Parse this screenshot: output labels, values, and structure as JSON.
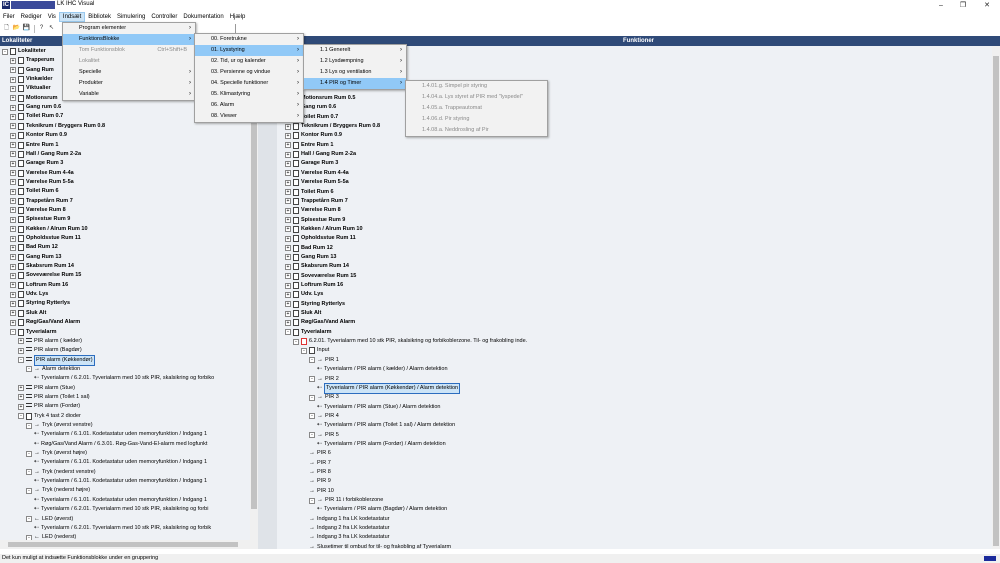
{
  "window": {
    "title": "LK IHC Visual",
    "logo": "IC",
    "minimize": "–",
    "maximize": "❐",
    "close": "✕"
  },
  "menubar": [
    "Filer",
    "Rediger",
    "Vis",
    "Indsæt",
    "Bibliotek",
    "Simulering",
    "Controller",
    "Dokumentation",
    "Hjælp"
  ],
  "toolbar": {
    "icons": [
      "new-icon",
      "open-icon",
      "save-icon",
      "help-icon",
      "pointer-icon"
    ]
  },
  "panes": {
    "left_title": "Lokaliteter",
    "right_title": "Funktioner"
  },
  "indsaet_menu": [
    {
      "label": "Program elementer",
      "has_sub": true,
      "disabled": false,
      "highlighted": false,
      "shortcut": ""
    },
    {
      "label": "FunktionsBlokke",
      "has_sub": true,
      "disabled": false,
      "highlighted": true,
      "shortcut": ""
    },
    {
      "label": "Tom Funktionsblok",
      "has_sub": false,
      "disabled": true,
      "highlighted": false,
      "shortcut": "Ctrl+Shift+B"
    },
    {
      "label": "Lokalitet",
      "has_sub": false,
      "disabled": true,
      "highlighted": false,
      "shortcut": ""
    },
    {
      "label": "Specielle",
      "has_sub": true,
      "disabled": false,
      "highlighted": false,
      "shortcut": ""
    },
    {
      "label": "Produkter",
      "has_sub": true,
      "disabled": false,
      "highlighted": false,
      "shortcut": ""
    },
    {
      "label": "Variable",
      "has_sub": true,
      "disabled": false,
      "highlighted": false,
      "shortcut": ""
    }
  ],
  "funktionsblokke_menu": [
    {
      "label": "00. Foretrukne",
      "highlighted": false
    },
    {
      "label": "01. Lysstyring",
      "highlighted": true
    },
    {
      "label": "02. Tid, ur og kalender",
      "highlighted": false
    },
    {
      "label": "03. Persienne og vindue",
      "highlighted": false
    },
    {
      "label": "04. Specielle funktioner",
      "highlighted": false
    },
    {
      "label": "05. Klimastyring",
      "highlighted": false
    },
    {
      "label": "06. Alarm",
      "highlighted": false
    },
    {
      "label": "08. Viewer",
      "highlighted": false
    }
  ],
  "lysstyring_menu": [
    {
      "label": "1.1 Generelt",
      "highlighted": false
    },
    {
      "label": "1.2 Lysdæmpning",
      "highlighted": false
    },
    {
      "label": "1.3 Lys og ventilation",
      "highlighted": false
    },
    {
      "label": "1.4 PIR og Timer",
      "highlighted": true
    }
  ],
  "pir_timer_menu": [
    "1.4.01.g. Simpel pir styring",
    "1.4.04.a. Lys styret af PIR med \"lyspedel\"",
    "1.4.05.a. Trappeautomat",
    "1.4.06.d. Pir styring",
    "1.4.08.a. Neddrosling af Pir"
  ],
  "left_tree": [
    {
      "t": "Lokaliteter",
      "lvl": 0,
      "exp": "-",
      "kind": "root"
    },
    {
      "t": "Trapperum",
      "lvl": 1,
      "exp": "+",
      "kind": "room"
    },
    {
      "t": "Gang Rum",
      "lvl": 1,
      "exp": "+",
      "kind": "room"
    },
    {
      "t": "Vinkælder",
      "lvl": 1,
      "exp": "+",
      "kind": "room"
    },
    {
      "t": "Viktualier",
      "lvl": 1,
      "exp": "+",
      "kind": "room"
    },
    {
      "t": "Motionsrum",
      "lvl": 1,
      "exp": "+",
      "kind": "room"
    },
    {
      "t": "Gang rum 0.6",
      "lvl": 1,
      "exp": "+",
      "kind": "room"
    },
    {
      "t": "Toilet Rum 0.7",
      "lvl": 1,
      "exp": "+",
      "kind": "room"
    },
    {
      "t": "Teknikrum / Bryggers Rum 0.8",
      "lvl": 1,
      "exp": "+",
      "kind": "room"
    },
    {
      "t": "Kontor Rum 0.9",
      "lvl": 1,
      "exp": "+",
      "kind": "room"
    },
    {
      "t": "Entre Rum 1",
      "lvl": 1,
      "exp": "+",
      "kind": "room"
    },
    {
      "t": "Hall / Gang Rum 2-2a",
      "lvl": 1,
      "exp": "+",
      "kind": "room"
    },
    {
      "t": "Garage Rum 3",
      "lvl": 1,
      "exp": "+",
      "kind": "room"
    },
    {
      "t": "Værelse Rum 4-4a",
      "lvl": 1,
      "exp": "+",
      "kind": "room"
    },
    {
      "t": "Værelse Rum 5-5a",
      "lvl": 1,
      "exp": "+",
      "kind": "room"
    },
    {
      "t": "Toilet Rum 6",
      "lvl": 1,
      "exp": "+",
      "kind": "room"
    },
    {
      "t": "Trappetårn Rum 7",
      "lvl": 1,
      "exp": "+",
      "kind": "room"
    },
    {
      "t": "Værelse Rum 8",
      "lvl": 1,
      "exp": "+",
      "kind": "room"
    },
    {
      "t": "Spisestue Rum 9",
      "lvl": 1,
      "exp": "+",
      "kind": "room"
    },
    {
      "t": "Køkken / Alrum Rum 10",
      "lvl": 1,
      "exp": "+",
      "kind": "room"
    },
    {
      "t": "Opholdsstue Rum 11",
      "lvl": 1,
      "exp": "+",
      "kind": "room"
    },
    {
      "t": "Bad Rum 12",
      "lvl": 1,
      "exp": "+",
      "kind": "room"
    },
    {
      "t": "Gang Rum 13",
      "lvl": 1,
      "exp": "+",
      "kind": "room"
    },
    {
      "t": "Skabsrum Rum 14",
      "lvl": 1,
      "exp": "+",
      "kind": "room"
    },
    {
      "t": "Soveværelse Rum 15",
      "lvl": 1,
      "exp": "+",
      "kind": "room"
    },
    {
      "t": "Loftrum Rum 16",
      "lvl": 1,
      "exp": "+",
      "kind": "room"
    },
    {
      "t": "Udv. Lys",
      "lvl": 1,
      "exp": "+",
      "kind": "room"
    },
    {
      "t": "Styring Rytterlys",
      "lvl": 1,
      "exp": "+",
      "kind": "room"
    },
    {
      "t": "Sluk Alt",
      "lvl": 1,
      "exp": "+",
      "kind": "room"
    },
    {
      "t": "Røg/Gas/Vand Alarm",
      "lvl": 1,
      "exp": "+",
      "kind": "room"
    },
    {
      "t": "Tyverialarm",
      "lvl": 1,
      "exp": "-",
      "kind": "room"
    },
    {
      "t": "PIR alarm ( kælder)",
      "lvl": 2,
      "exp": "+",
      "kind": "pir"
    },
    {
      "t": "PIR alarm (Bagdør)",
      "lvl": 2,
      "exp": "+",
      "kind": "pir"
    },
    {
      "t": "PIR alarm (Køkkendør)",
      "lvl": 2,
      "exp": "-",
      "kind": "pir",
      "sel": true
    },
    {
      "t": "Alarm detektion",
      "lvl": 3,
      "exp": "-",
      "kind": "out"
    },
    {
      "t": "Tyverialarm / 6.2.01. Tyverialarm med 10 stk PIR, skalsikring og forbiko",
      "lvl": 4,
      "exp": "",
      "kind": "link"
    },
    {
      "t": "PIR alarm (Stue)",
      "lvl": 2,
      "exp": "+",
      "kind": "pir"
    },
    {
      "t": "PIR alarm (Toilet 1 sal)",
      "lvl": 2,
      "exp": "+",
      "kind": "pir"
    },
    {
      "t": "PIR alarm (Fordør)",
      "lvl": 2,
      "exp": "+",
      "kind": "pir"
    },
    {
      "t": "Tryk 4 tast 2 dioder",
      "lvl": 2,
      "exp": "-",
      "kind": "key"
    },
    {
      "t": "Tryk (øverst venstre)",
      "lvl": 3,
      "exp": "-",
      "kind": "out"
    },
    {
      "t": "Tyverialarm / 6.1.01. Kodetastatur uden memoryfunktion / Indgang 1",
      "lvl": 4,
      "exp": "",
      "kind": "link"
    },
    {
      "t": "Røg/Gas/Vand Alarm / 6.3.01. Røg-Gas-Vand-El-alarm med logfunkt",
      "lvl": 4,
      "exp": "",
      "kind": "link"
    },
    {
      "t": "Tryk (øverst højre)",
      "lvl": 3,
      "exp": "-",
      "kind": "out"
    },
    {
      "t": "Tyverialarm / 6.1.01. Kodetastatur uden memoryfunktion / Indgang 1",
      "lvl": 4,
      "exp": "",
      "kind": "link"
    },
    {
      "t": "Tryk (nederst venstre)",
      "lvl": 3,
      "exp": "-",
      "kind": "out"
    },
    {
      "t": "Tyverialarm / 6.1.01. Kodetastatur uden memoryfunktion / Indgang 1",
      "lvl": 4,
      "exp": "",
      "kind": "link"
    },
    {
      "t": "Tryk (nederst højre)",
      "lvl": 3,
      "exp": "-",
      "kind": "out"
    },
    {
      "t": "Tyverialarm / 6.1.01. Kodetastatur uden memoryfunktion / Indgang 1",
      "lvl": 4,
      "exp": "",
      "kind": "link"
    },
    {
      "t": "Tyverialarm / 6.2.01. Tyverialarm med 10 stk PIR, skalsikring og forbi",
      "lvl": 4,
      "exp": "",
      "kind": "link"
    },
    {
      "t": "LED (øverst)",
      "lvl": 3,
      "exp": "-",
      "kind": "in"
    },
    {
      "t": "Tyverialarm / 6.2.01. Tyverialarm med 10 stk PIR, skalsikring og forbik",
      "lvl": 4,
      "exp": "",
      "kind": "link"
    },
    {
      "t": "LED (nederst)",
      "lvl": 3,
      "exp": "-",
      "kind": "in"
    }
  ],
  "right_tree": [
    {
      "t": "Motionsrum Rum 0.5",
      "lvl": 1,
      "exp": "+",
      "kind": "room"
    },
    {
      "t": "Gang rum 0.6",
      "lvl": 1,
      "exp": "+",
      "kind": "room"
    },
    {
      "t": "Toilet Rum 0.7",
      "lvl": 1,
      "exp": "+",
      "kind": "room"
    },
    {
      "t": "Teknikrum / Bryggers Rum 0.8",
      "lvl": 1,
      "exp": "+",
      "kind": "room"
    },
    {
      "t": "Kontor Rum 0.9",
      "lvl": 1,
      "exp": "+",
      "kind": "room"
    },
    {
      "t": "Entre Rum 1",
      "lvl": 1,
      "exp": "+",
      "kind": "room"
    },
    {
      "t": "Hall / Gang Rum 2-2a",
      "lvl": 1,
      "exp": "+",
      "kind": "room"
    },
    {
      "t": "Garage Rum 3",
      "lvl": 1,
      "exp": "+",
      "kind": "room"
    },
    {
      "t": "Værelse Rum 4-4a",
      "lvl": 1,
      "exp": "+",
      "kind": "room"
    },
    {
      "t": "Værelse Rum 5-5a",
      "lvl": 1,
      "exp": "+",
      "kind": "room"
    },
    {
      "t": "Toilet Rum 6",
      "lvl": 1,
      "exp": "+",
      "kind": "room"
    },
    {
      "t": "Trappetårn Rum 7",
      "lvl": 1,
      "exp": "+",
      "kind": "room"
    },
    {
      "t": "Værelse Rum 8",
      "lvl": 1,
      "exp": "+",
      "kind": "room"
    },
    {
      "t": "Spisestue Rum 9",
      "lvl": 1,
      "exp": "+",
      "kind": "room"
    },
    {
      "t": "Køkken / Alrum Rum 10",
      "lvl": 1,
      "exp": "+",
      "kind": "room"
    },
    {
      "t": "Opholdsstue Rum 11",
      "lvl": 1,
      "exp": "+",
      "kind": "room"
    },
    {
      "t": "Bad Rum 12",
      "lvl": 1,
      "exp": "+",
      "kind": "room"
    },
    {
      "t": "Gang Rum 13",
      "lvl": 1,
      "exp": "+",
      "kind": "room"
    },
    {
      "t": "Skabsrum Rum 14",
      "lvl": 1,
      "exp": "+",
      "kind": "room"
    },
    {
      "t": "Soveværelse Rum 15",
      "lvl": 1,
      "exp": "+",
      "kind": "room"
    },
    {
      "t": "Loftrum Rum 16",
      "lvl": 1,
      "exp": "+",
      "kind": "room"
    },
    {
      "t": "Udv. Lys",
      "lvl": 1,
      "exp": "+",
      "kind": "room"
    },
    {
      "t": "Styring Rytterlys",
      "lvl": 1,
      "exp": "+",
      "kind": "room"
    },
    {
      "t": "Sluk Alt",
      "lvl": 1,
      "exp": "+",
      "kind": "room"
    },
    {
      "t": "Røg/Gas/Vand Alarm",
      "lvl": 1,
      "exp": "+",
      "kind": "room"
    },
    {
      "t": "Tyverialarm",
      "lvl": 1,
      "exp": "-",
      "kind": "room"
    },
    {
      "t": "6.2.01. Tyverialarm med 10 stk PIR, skalsikring og forbikoblerzone. Til- og frakobling inde.",
      "lvl": 2,
      "exp": "-",
      "kind": "fb"
    },
    {
      "t": "Input",
      "lvl": 3,
      "exp": "-",
      "kind": "inbox"
    },
    {
      "t": "PIR 1",
      "lvl": 4,
      "exp": "-",
      "kind": "out"
    },
    {
      "t": "Tyverialarm / PIR alarm ( kælder)  / Alarm detektion",
      "lvl": 5,
      "exp": "",
      "kind": "link"
    },
    {
      "t": "PIR 2",
      "lvl": 4,
      "exp": "-",
      "kind": "out"
    },
    {
      "t": "Tyverialarm / PIR alarm (Køkkendør) / Alarm detektion",
      "lvl": 5,
      "exp": "",
      "kind": "link",
      "sel": true
    },
    {
      "t": "PIR 3",
      "lvl": 4,
      "exp": "-",
      "kind": "out"
    },
    {
      "t": "Tyverialarm / PIR alarm (Stue)  / Alarm detektion",
      "lvl": 5,
      "exp": "",
      "kind": "link"
    },
    {
      "t": "PIR 4",
      "lvl": 4,
      "exp": "-",
      "kind": "out"
    },
    {
      "t": "Tyverialarm / PIR alarm (Toilet 1 sal)  / Alarm detektion",
      "lvl": 5,
      "exp": "",
      "kind": "link"
    },
    {
      "t": "PIR 5",
      "lvl": 4,
      "exp": "-",
      "kind": "out"
    },
    {
      "t": "Tyverialarm / PIR alarm (Fordør)  / Alarm detektion",
      "lvl": 5,
      "exp": "",
      "kind": "link"
    },
    {
      "t": "PIR 6",
      "lvl": 4,
      "exp": "",
      "kind": "out"
    },
    {
      "t": "PIR 7",
      "lvl": 4,
      "exp": "",
      "kind": "out"
    },
    {
      "t": "PIR 8",
      "lvl": 4,
      "exp": "",
      "kind": "out"
    },
    {
      "t": "PIR 9",
      "lvl": 4,
      "exp": "",
      "kind": "out"
    },
    {
      "t": "PIR 10",
      "lvl": 4,
      "exp": "",
      "kind": "out"
    },
    {
      "t": "PIR 11 i forbikoblerzone",
      "lvl": 4,
      "exp": "-",
      "kind": "out"
    },
    {
      "t": "Tyverialarm / PIR alarm (Bagdør)  / Alarm detektion",
      "lvl": 5,
      "exp": "",
      "kind": "link"
    },
    {
      "t": "Indgang 1 fra LK kodetastatur",
      "lvl": 4,
      "exp": "",
      "kind": "out"
    },
    {
      "t": "Indgang 2 fra LK kodetastatur",
      "lvl": 4,
      "exp": "",
      "kind": "out"
    },
    {
      "t": "Indgang 3 fra LK kodetastatur",
      "lvl": 4,
      "exp": "",
      "kind": "out"
    },
    {
      "t": "Slusetimer til ombud for til- og frakobling af Tyverialarm",
      "lvl": 4,
      "exp": "",
      "kind": "out"
    }
  ],
  "status": {
    "text": "Det kun muligt at indsætte Funktionsblokke under en gruppering"
  }
}
